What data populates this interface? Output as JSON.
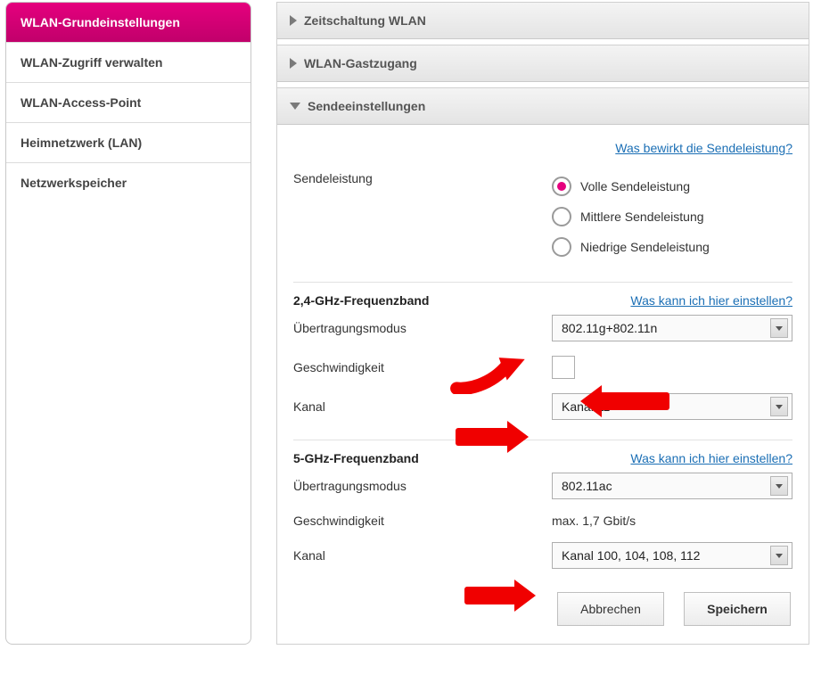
{
  "sidebar": {
    "items": [
      {
        "label": "WLAN-Grundeinstellungen",
        "active": true
      },
      {
        "label": "WLAN-Zugriff verwalten",
        "active": false
      },
      {
        "label": "WLAN-Access-Point",
        "active": false
      },
      {
        "label": "Heimnetzwerk (LAN)",
        "active": false
      },
      {
        "label": "Netzwerkspeicher",
        "active": false
      }
    ]
  },
  "accordion": {
    "time": {
      "title": "Zeitschaltung WLAN",
      "open": false
    },
    "guest": {
      "title": "WLAN-Gastzugang",
      "open": false
    },
    "tx": {
      "title": "Sendeeinstellungen",
      "open": true
    }
  },
  "tx": {
    "help_link": "Was bewirkt die Sendeleistung?",
    "power_label": "Sendeleistung",
    "power_options": {
      "full": "Volle Sendeleistung",
      "medium": "Mittlere Sendeleistung",
      "low": "Niedrige Sendeleistung"
    },
    "power_selected": "full"
  },
  "band24": {
    "title": "2,4-GHz-Frequenzband",
    "help_link": "Was kann ich hier einstellen?",
    "mode_label": "Übertragungsmodus",
    "mode_value": "802.11g+802.11n",
    "speed_label": "Geschwindigkeit",
    "speed_checked": false,
    "channel_label": "Kanal",
    "channel_value": "Kanal 11"
  },
  "band5": {
    "title": "5-GHz-Frequenzband",
    "help_link": "Was kann ich hier einstellen?",
    "mode_label": "Übertragungsmodus",
    "mode_value": "802.11ac",
    "speed_label": "Geschwindigkeit",
    "speed_value": "max. 1,7 Gbit/s",
    "channel_label": "Kanal",
    "channel_value": "Kanal 100, 104, 108, 112"
  },
  "footer": {
    "cancel": "Abbrechen",
    "save": "Speichern"
  },
  "annotation": {
    "arrows": [
      {
        "points_to": "band24.mode_select",
        "direction": "right"
      },
      {
        "points_to": "band24.speed_checkbox",
        "direction": "left"
      },
      {
        "points_to": "band24.channel_select",
        "direction": "right"
      },
      {
        "points_to": "band5.channel_select",
        "direction": "right"
      }
    ],
    "color": "#f00000",
    "style": "hand-drawn"
  }
}
